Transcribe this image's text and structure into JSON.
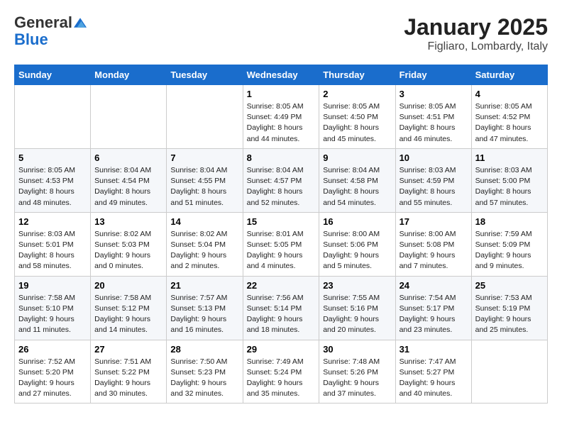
{
  "header": {
    "logo_line1": "General",
    "logo_line2": "Blue",
    "title": "January 2025",
    "subtitle": "Figliaro, Lombardy, Italy"
  },
  "weekdays": [
    "Sunday",
    "Monday",
    "Tuesday",
    "Wednesday",
    "Thursday",
    "Friday",
    "Saturday"
  ],
  "weeks": [
    [
      {
        "day": "",
        "info": ""
      },
      {
        "day": "",
        "info": ""
      },
      {
        "day": "",
        "info": ""
      },
      {
        "day": "1",
        "info": "Sunrise: 8:05 AM\nSunset: 4:49 PM\nDaylight: 8 hours\nand 44 minutes."
      },
      {
        "day": "2",
        "info": "Sunrise: 8:05 AM\nSunset: 4:50 PM\nDaylight: 8 hours\nand 45 minutes."
      },
      {
        "day": "3",
        "info": "Sunrise: 8:05 AM\nSunset: 4:51 PM\nDaylight: 8 hours\nand 46 minutes."
      },
      {
        "day": "4",
        "info": "Sunrise: 8:05 AM\nSunset: 4:52 PM\nDaylight: 8 hours\nand 47 minutes."
      }
    ],
    [
      {
        "day": "5",
        "info": "Sunrise: 8:05 AM\nSunset: 4:53 PM\nDaylight: 8 hours\nand 48 minutes."
      },
      {
        "day": "6",
        "info": "Sunrise: 8:04 AM\nSunset: 4:54 PM\nDaylight: 8 hours\nand 49 minutes."
      },
      {
        "day": "7",
        "info": "Sunrise: 8:04 AM\nSunset: 4:55 PM\nDaylight: 8 hours\nand 51 minutes."
      },
      {
        "day": "8",
        "info": "Sunrise: 8:04 AM\nSunset: 4:57 PM\nDaylight: 8 hours\nand 52 minutes."
      },
      {
        "day": "9",
        "info": "Sunrise: 8:04 AM\nSunset: 4:58 PM\nDaylight: 8 hours\nand 54 minutes."
      },
      {
        "day": "10",
        "info": "Sunrise: 8:03 AM\nSunset: 4:59 PM\nDaylight: 8 hours\nand 55 minutes."
      },
      {
        "day": "11",
        "info": "Sunrise: 8:03 AM\nSunset: 5:00 PM\nDaylight: 8 hours\nand 57 minutes."
      }
    ],
    [
      {
        "day": "12",
        "info": "Sunrise: 8:03 AM\nSunset: 5:01 PM\nDaylight: 8 hours\nand 58 minutes."
      },
      {
        "day": "13",
        "info": "Sunrise: 8:02 AM\nSunset: 5:03 PM\nDaylight: 9 hours\nand 0 minutes."
      },
      {
        "day": "14",
        "info": "Sunrise: 8:02 AM\nSunset: 5:04 PM\nDaylight: 9 hours\nand 2 minutes."
      },
      {
        "day": "15",
        "info": "Sunrise: 8:01 AM\nSunset: 5:05 PM\nDaylight: 9 hours\nand 4 minutes."
      },
      {
        "day": "16",
        "info": "Sunrise: 8:00 AM\nSunset: 5:06 PM\nDaylight: 9 hours\nand 5 minutes."
      },
      {
        "day": "17",
        "info": "Sunrise: 8:00 AM\nSunset: 5:08 PM\nDaylight: 9 hours\nand 7 minutes."
      },
      {
        "day": "18",
        "info": "Sunrise: 7:59 AM\nSunset: 5:09 PM\nDaylight: 9 hours\nand 9 minutes."
      }
    ],
    [
      {
        "day": "19",
        "info": "Sunrise: 7:58 AM\nSunset: 5:10 PM\nDaylight: 9 hours\nand 11 minutes."
      },
      {
        "day": "20",
        "info": "Sunrise: 7:58 AM\nSunset: 5:12 PM\nDaylight: 9 hours\nand 14 minutes."
      },
      {
        "day": "21",
        "info": "Sunrise: 7:57 AM\nSunset: 5:13 PM\nDaylight: 9 hours\nand 16 minutes."
      },
      {
        "day": "22",
        "info": "Sunrise: 7:56 AM\nSunset: 5:14 PM\nDaylight: 9 hours\nand 18 minutes."
      },
      {
        "day": "23",
        "info": "Sunrise: 7:55 AM\nSunset: 5:16 PM\nDaylight: 9 hours\nand 20 minutes."
      },
      {
        "day": "24",
        "info": "Sunrise: 7:54 AM\nSunset: 5:17 PM\nDaylight: 9 hours\nand 23 minutes."
      },
      {
        "day": "25",
        "info": "Sunrise: 7:53 AM\nSunset: 5:19 PM\nDaylight: 9 hours\nand 25 minutes."
      }
    ],
    [
      {
        "day": "26",
        "info": "Sunrise: 7:52 AM\nSunset: 5:20 PM\nDaylight: 9 hours\nand 27 minutes."
      },
      {
        "day": "27",
        "info": "Sunrise: 7:51 AM\nSunset: 5:22 PM\nDaylight: 9 hours\nand 30 minutes."
      },
      {
        "day": "28",
        "info": "Sunrise: 7:50 AM\nSunset: 5:23 PM\nDaylight: 9 hours\nand 32 minutes."
      },
      {
        "day": "29",
        "info": "Sunrise: 7:49 AM\nSunset: 5:24 PM\nDaylight: 9 hours\nand 35 minutes."
      },
      {
        "day": "30",
        "info": "Sunrise: 7:48 AM\nSunset: 5:26 PM\nDaylight: 9 hours\nand 37 minutes."
      },
      {
        "day": "31",
        "info": "Sunrise: 7:47 AM\nSunset: 5:27 PM\nDaylight: 9 hours\nand 40 minutes."
      },
      {
        "day": "",
        "info": ""
      }
    ]
  ]
}
